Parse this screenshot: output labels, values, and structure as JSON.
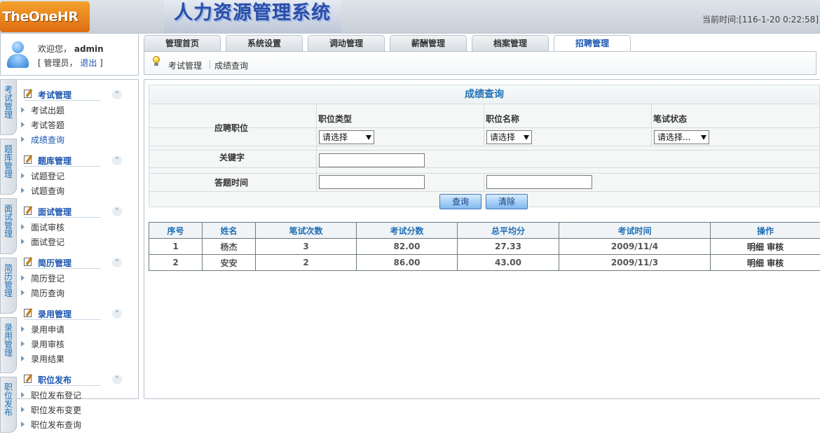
{
  "header": {
    "logo": "TheOneHR",
    "system_name": "人力资源管理系统",
    "clock": "当前时间:[116-1-20 0:22:58]"
  },
  "user": {
    "welcome": "欢迎您，",
    "name": "admin",
    "role_open": "[ 管理员，",
    "logout": "退出",
    "role_close": "]"
  },
  "tabs": [
    {
      "label": "管理首页"
    },
    {
      "label": "系统设置"
    },
    {
      "label": "调动管理"
    },
    {
      "label": "薪酬管理"
    },
    {
      "label": "档案管理"
    },
    {
      "label": "招聘管理",
      "active": true
    }
  ],
  "breadcrumb": {
    "section": "考试管理",
    "page": "成绩查询"
  },
  "vtabs": [
    {
      "label": "考试管理"
    },
    {
      "label": "题库管理"
    },
    {
      "label": "面试管理"
    },
    {
      "label": "简历管理"
    },
    {
      "label": "录用管理"
    },
    {
      "label": "职位发布"
    }
  ],
  "sidebar": {
    "groups": [
      {
        "title": "考试管理",
        "items": [
          {
            "label": "考试出题"
          },
          {
            "label": "考试答题"
          },
          {
            "label": "成绩查询",
            "active": true
          }
        ]
      },
      {
        "title": "题库管理",
        "items": [
          {
            "label": "试题登记"
          },
          {
            "label": "试题查询"
          }
        ]
      },
      {
        "title": "面试管理",
        "items": [
          {
            "label": "面试审核"
          },
          {
            "label": "面试登记"
          }
        ]
      },
      {
        "title": "简历管理",
        "items": [
          {
            "label": "简历登记"
          },
          {
            "label": "简历查询"
          }
        ]
      },
      {
        "title": "录用管理",
        "items": [
          {
            "label": "录用申请"
          },
          {
            "label": "录用审核"
          },
          {
            "label": "录用结果"
          }
        ]
      },
      {
        "title": "职位发布",
        "items": [
          {
            "label": "职位发布登记"
          },
          {
            "label": "职位发布变更"
          },
          {
            "label": "职位发布查询"
          }
        ]
      }
    ]
  },
  "search": {
    "title": "成绩查询",
    "position_label": "应聘职位",
    "job_type_label": "职位类型",
    "job_type_value": "请选择",
    "job_name_label": "职位名称",
    "job_name_value": "请选择",
    "exam_status_label": "笔试状态",
    "exam_status_value": "请选择...",
    "keyword_label": "关键字",
    "keyword_value": "",
    "answer_time_label": "答题时间",
    "answer_time_from": "",
    "answer_time_to": "",
    "query_button": "查询",
    "clear_button": "清除"
  },
  "results": {
    "headers": [
      "序号",
      "姓名",
      "笔试次数",
      "考试分数",
      "总平均分",
      "考试时间",
      "操作"
    ],
    "rows": [
      {
        "no": "1",
        "name": "杨杰",
        "times": "3",
        "score": "82.00",
        "avg": "27.33",
        "date": "2009/11/4",
        "action_detail": "明细",
        "action_review": "审核"
      },
      {
        "no": "2",
        "name": "安安",
        "times": "2",
        "score": "86.00",
        "avg": "43.00",
        "date": "2009/11/3",
        "action_detail": "明细",
        "action_review": "审核"
      }
    ]
  }
}
